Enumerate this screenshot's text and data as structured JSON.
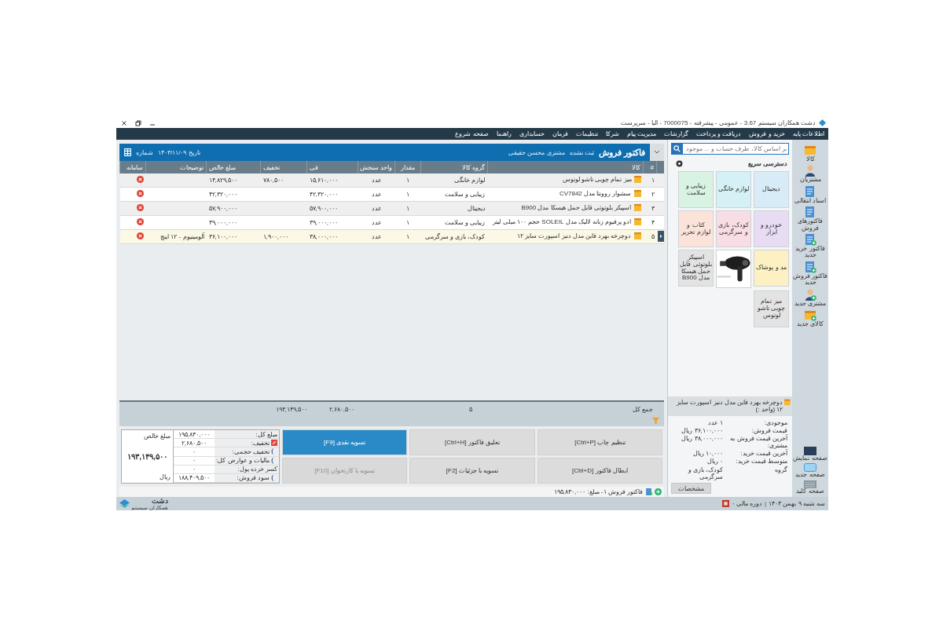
{
  "window": {
    "title": "دشت همکاران سیستم 3.67 - عمومی - پیشرفته - 7000075 - الیا - سرپرست"
  },
  "menu": [
    "اطلاعات پایه",
    "خرید و فروش",
    "دریافت و پرداخت",
    "گزارشات",
    "مدیریت پیام",
    "شرکا",
    "تنظیمات",
    "فرمان",
    "حسابداری",
    "راهنما",
    "صفحه شروع"
  ],
  "rail": [
    {
      "kind": "box",
      "label": "کالا"
    },
    {
      "kind": "person",
      "label": "مشتریان"
    },
    {
      "kind": "doc",
      "label": "اسناد انتقالی"
    },
    {
      "kind": "doc",
      "label": "فاکتورهای فروش"
    },
    {
      "kind": "newdoc",
      "label": "فاکتور خرید جدید"
    },
    {
      "kind": "newdoc",
      "label": "فاکتور فروش جدید"
    },
    {
      "kind": "newperson",
      "label": "مشتری جدید"
    },
    {
      "kind": "newbox",
      "label": "کالای جدید"
    }
  ],
  "rail_bottom": [
    {
      "kind": "screen",
      "label": "صفحه نمایش"
    },
    {
      "kind": "window",
      "label": "صفحه جدید"
    },
    {
      "kind": "keyboard",
      "label": "صفحه کلید"
    }
  ],
  "search": {
    "placeholder": "بر اساس کالا، طرف حساب و ... موجود"
  },
  "quick_access": {
    "title": "دسترسی سریع",
    "tiles": [
      {
        "kind": "text",
        "label": "دیجیتال",
        "color": "#d8ecf8"
      },
      {
        "kind": "text",
        "label": "لوازم خانگی",
        "color": "#d5f1f5"
      },
      {
        "kind": "text",
        "label": "زیبایی و سلامت",
        "color": "#d9f3e3"
      },
      {
        "kind": "text",
        "label": "خودرو و ابزار",
        "color": "#e8dcf5"
      },
      {
        "kind": "text",
        "label": "کودک، بازی و سرگرمی",
        "color": "#f9dde4"
      },
      {
        "kind": "text",
        "label": "کتاب و لوازم تحریر",
        "color": "#fbe3da"
      },
      {
        "kind": "text",
        "label": "مد و پوشاک",
        "color": "#fdf1c4"
      },
      {
        "kind": "picture"
      },
      {
        "kind": "text",
        "label": "اسپیکر بلوتوثی قابل حمل هیسکا مدل B900",
        "color": "#e3e3e3"
      },
      {
        "kind": "text",
        "label": "میز تمام چوبی تاشو لوتوس",
        "color": "#e3e3e3"
      }
    ]
  },
  "product": {
    "title": "دوچرخه بهرد فاین مدل دنیز اسپورت سایز ۱۲ (واحد :)",
    "details": [
      {
        "label": "موجودی:",
        "value": "۱ عدد"
      },
      {
        "label": "قیمت فروش:",
        "value": "۳۶,۱۰۰,۰۰۰ ریال"
      },
      {
        "label": "آخرین قیمت فروش به مشتری:",
        "value": "۳۸,۰۰۰,۰۰۰ ریال"
      },
      {
        "label": "آخرین قیمت خرید:",
        "value": "۱۰,۰۰۰ ریال"
      },
      {
        "label": "متوسط قیمت خرید:",
        "value": "۰ ریال"
      },
      {
        "label": "گروه",
        "value": "کودک، بازی و سرگرمی"
      }
    ],
    "button": "مشخصات"
  },
  "invoice": {
    "title": "فاکتور فروش",
    "status": "ثبت نشده",
    "customer": "مشتری محسن حقیقی",
    "date": "تاریخ ۱۴۰۳/۱۱/۰۹",
    "number_label": "شماره"
  },
  "table": {
    "columns": [
      "#",
      "کالا",
      "گروه کالا",
      "مقدار",
      "واحد سنجش",
      "فی",
      "تخفیف",
      "مبلغ خالص",
      "توضیحات",
      "سامانه"
    ],
    "rows": [
      {
        "index": "۱",
        "item": "میز تمام چوبی تاشو لوتوس",
        "group": "لوازم خانگی",
        "qty": "۱",
        "unit": "عدد",
        "price": "۱۵,۶۱۰,۰۰۰",
        "discount": "۷۸۰,۵۰۰",
        "net": "۱۴,۸۲۹,۵۰۰",
        "note": "",
        "selected": false
      },
      {
        "index": "۲",
        "item": "سشوار روونتا مدل CV7842",
        "group": "زیبایی و سلامت",
        "qty": "۱",
        "unit": "عدد",
        "price": "۴۲,۳۲۰,۰۰۰",
        "discount": "",
        "net": "۴۲,۳۲۰,۰۰۰",
        "note": "",
        "selected": false
      },
      {
        "index": "۳",
        "item": "اسپیکر بلوتوثی قابل حمل هیسکا مدل B900",
        "group": "دیجیتال",
        "qty": "۱",
        "unit": "عدد",
        "price": "۵۷,۹۰۰,۰۰۰",
        "discount": "",
        "net": "۵۷,۹۰۰,۰۰۰",
        "note": "",
        "selected": false
      },
      {
        "index": "۴",
        "item": "ادو پرفیوم زنانه لالیک مدل SOLEIL حجم ۱۰۰ میلی لیتر",
        "group": "زیبایی و سلامت",
        "qty": "۱",
        "unit": "عدد",
        "price": "۳۹,۰۰۰,۰۰۰",
        "discount": "",
        "net": "۳۹,۰۰۰,۰۰۰",
        "note": "",
        "selected": false
      },
      {
        "index": "۵",
        "item": "دوچرخه بهرد فاین مدل دنیز اسپورت سایز ۱۲",
        "group": "کودک، بازی و سرگرمی",
        "qty": "۱",
        "unit": "عدد",
        "price": "۳۸,۰۰۰,۰۰۰",
        "discount": "۱,۹۰۰,۰۰۰",
        "net": "۳۶,۱۰۰,۰۰۰",
        "note": "آلومینیوم - ۱۲ اینچ",
        "selected": true
      }
    ]
  },
  "totals": {
    "label": "جمع کل",
    "qty": "۵",
    "discount": "۲,۶۸۰,۵۰۰",
    "net": "۱۹۳,۱۴۹,۵۰۰"
  },
  "actions": [
    {
      "label": "تنظیم چاپ [Ctrl+P]",
      "kind": "normal"
    },
    {
      "label": "تعلیق فاکتور [Ctrl+H]",
      "kind": "normal"
    },
    {
      "label": "تسویه نقدی [F9]",
      "kind": "primary"
    },
    {
      "label": "ابطال فاکتور [Ctrl+D]",
      "kind": "normal"
    },
    {
      "label": "تسویه با جزئیات [F2]",
      "kind": "normal"
    },
    {
      "label": "تسویه با کارتخوان [F10]",
      "kind": "disabled"
    }
  ],
  "summary": {
    "rows": [
      {
        "label": "مبلغ کل:",
        "value": "۱۹۵,۸۳۰,۰۰۰",
        "kind": "plain"
      },
      {
        "label": "تخفیف:",
        "value": "۲,۶۸۰,۵۰۰",
        "kind": "badge"
      },
      {
        "label": "تخفیف حجمی:",
        "value": "۰",
        "kind": "moon"
      },
      {
        "label": "مالیات و عوارض کل:",
        "value": "۰",
        "kind": "moon"
      },
      {
        "label": "کسر خرده پول:",
        "value": "۰",
        "kind": "plain"
      },
      {
        "label": "سود فروش:",
        "value": "۱۸۸,۴۰۹,۵۰۰",
        "kind": "moon"
      }
    ],
    "net_label": "مبلغ خالص",
    "net": "۱۹۳,۱۴۹,۵۰۰",
    "currency": "ریال"
  },
  "status_line": "فاکتور فروش ۱- مبلغ: ۱۹۵,۸۳۰,۰۰۰",
  "status_bar": {
    "date": "سه شنبه ۹ بهمن ۱۴۰۳",
    "separator": "|",
    "period": "دوره مالی ۰",
    "logo": "دشت",
    "logo_sub": "همکاران سیستم"
  }
}
